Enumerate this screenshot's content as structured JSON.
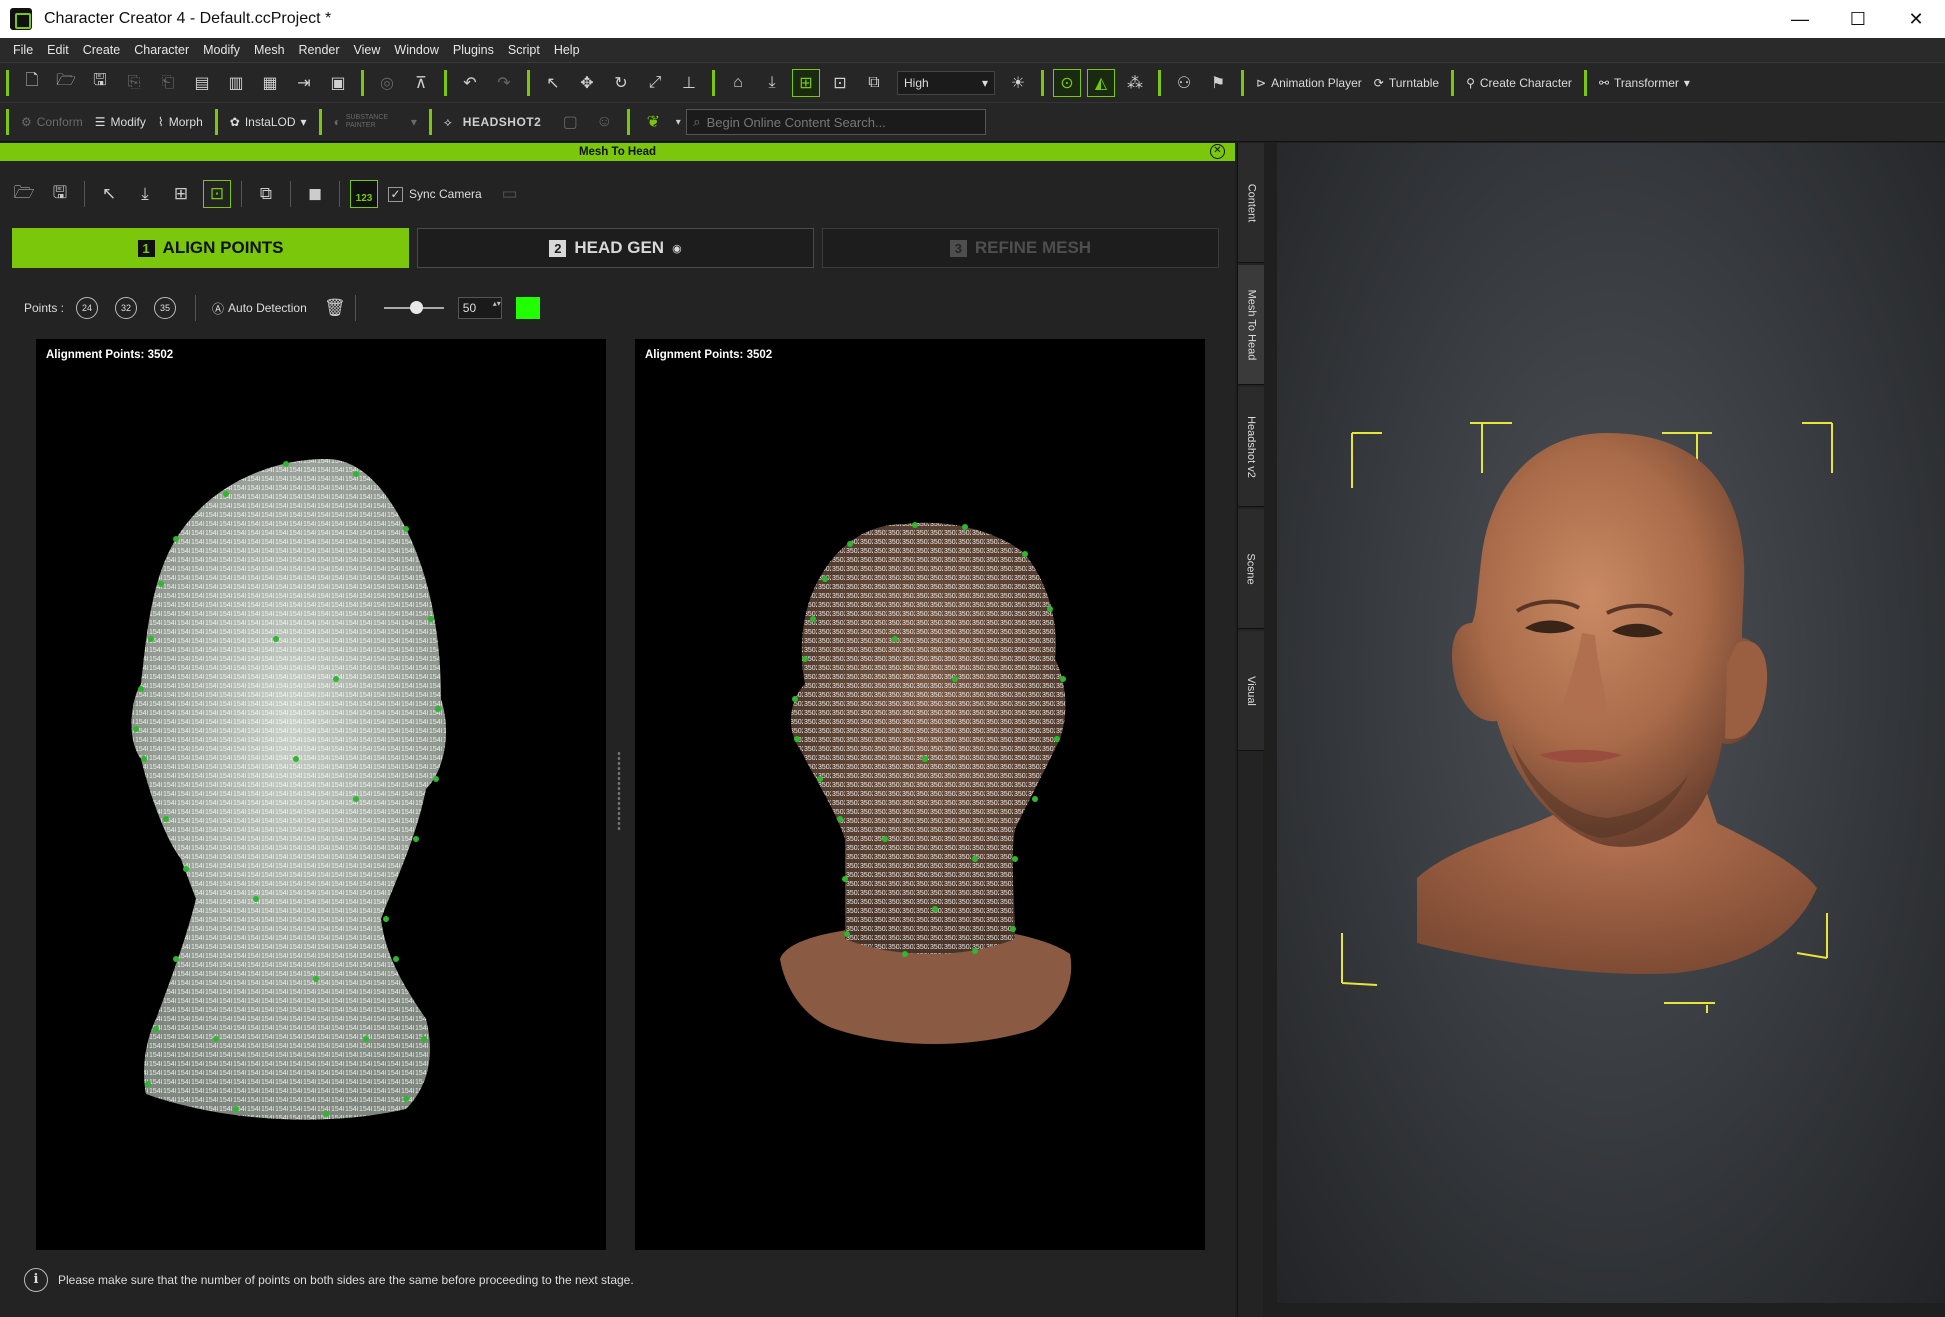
{
  "window": {
    "title": "Character Creator 4 - Default.ccProject *",
    "controls": [
      "—",
      "☐",
      "✕"
    ]
  },
  "menu": [
    "File",
    "Edit",
    "Create",
    "Character",
    "Modify",
    "Mesh",
    "Render",
    "View",
    "Window",
    "Plugins",
    "Script",
    "Help"
  ],
  "toolbar1": {
    "quality_select": "High",
    "animation_player": "Animation Player",
    "turntable": "Turntable",
    "create_character": "Create Character",
    "transformer": "Transformer"
  },
  "toolbar2": {
    "conform": "Conform",
    "modify": "Modify",
    "morph": "Morph",
    "instalod": "InstaLOD",
    "substance": "SUBSTANCE PAINTER",
    "headshot": "HEADSHOT2",
    "search_placeholder": "Begin Online Content Search..."
  },
  "panel": {
    "title": "Mesh To Head",
    "sync_camera": "Sync Camera",
    "num_badge": "123",
    "steps": [
      {
        "num": "1",
        "label": "ALIGN POINTS"
      },
      {
        "num": "2",
        "label": "HEAD GEN"
      },
      {
        "num": "3",
        "label": "REFINE MESH"
      }
    ],
    "points_label": "Points :",
    "point_presets": [
      "24",
      "32",
      "35"
    ],
    "auto_detection": "Auto Detection",
    "size_value": "50",
    "swatch_color": "#22ff00",
    "left_view_label": "Alignment Points: 3502",
    "right_view_label": "Alignment Points: 3502",
    "info_text": "Please make sure that the number of points on both sides are the same before proceeding to the next stage."
  },
  "side_tabs": [
    "Content",
    "Mesh To Head",
    "Headshot v2",
    "Scene",
    "Visual"
  ],
  "colors": {
    "accent": "#7ac70c",
    "point_marker": "#2eb82e"
  }
}
